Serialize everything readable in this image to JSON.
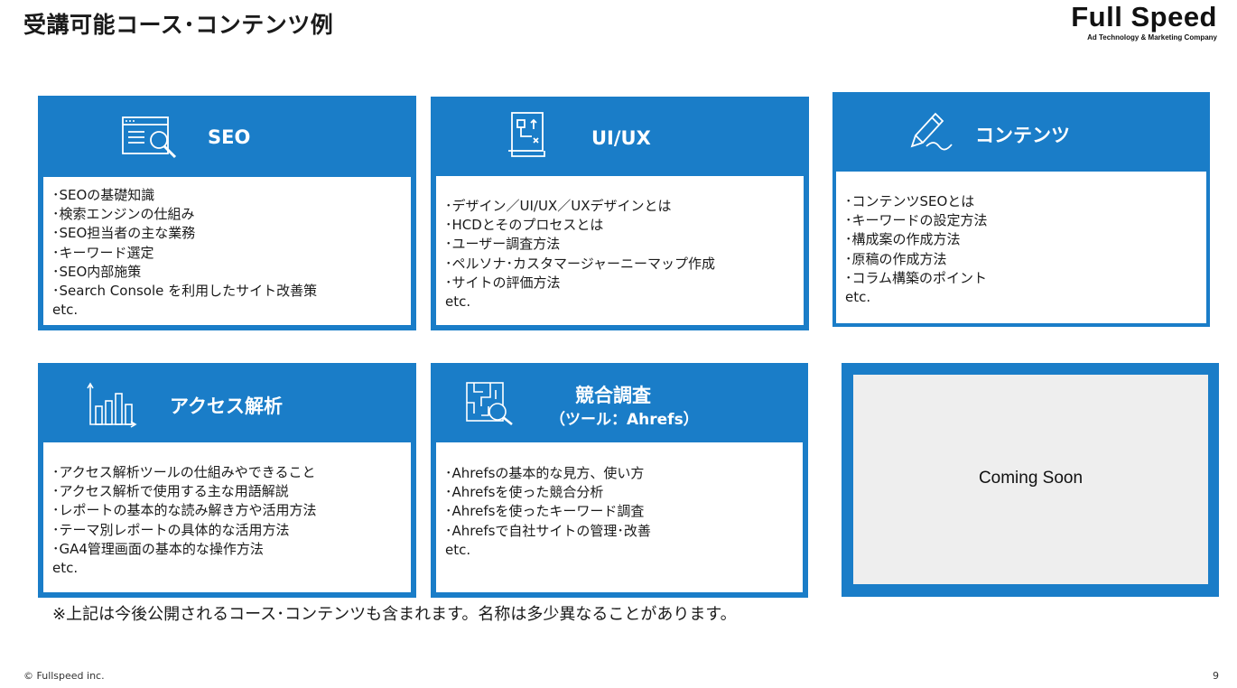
{
  "slide": {
    "title": "受講可能コース･コンテンツ例",
    "page_number": "9",
    "copyright": "© Fullspeed inc.",
    "note": "※上記は今後公開されるコース･コンテンツも含まれます。名称は多少異なることがあります。"
  },
  "logo": {
    "name": "Full Speed",
    "tagline": "Ad Technology & Marketing Company"
  },
  "cards": [
    {
      "title": "SEO",
      "icon": "browser-search-icon",
      "items": [
        "･SEOの基礎知識",
        "･検索エンジンの仕組み",
        "･SEO担当者の主な業務",
        "･キーワード選定",
        "･SEO内部施策",
        "･Search Console を利用したサイト改善策",
        "etc."
      ]
    },
    {
      "title": "UI/UX",
      "icon": "wireframe-icon",
      "items": [
        "･デザイン／UI/UX／UXデザインとは",
        "･HCDとそのプロセスとは",
        "･ユーザー調査方法",
        "･ペルソナ･カスタマージャーニーマップ作成",
        "･サイトの評価方法",
        "etc."
      ]
    },
    {
      "title": "コンテンツ",
      "icon": "pen-writing-icon",
      "items": [
        "･コンテンツSEOとは",
        "･キーワードの設定方法",
        "･構成案の作成方法",
        "･原稿の作成方法",
        "･コラム構築のポイント",
        "etc."
      ]
    },
    {
      "title": "アクセス解析",
      "icon": "bar-chart-icon",
      "items": [
        "･アクセス解析ツールの仕組みやできること",
        "･アクセス解析で使用する主な用語解説",
        "･レポートの基本的な読み解き方や活用方法",
        "･テーマ別レポートの具体的な活用方法",
        "･GA4管理画面の基本的な操作方法",
        "etc."
      ]
    },
    {
      "title": "競合調査",
      "subtitle": "（ツール：Ahrefs）",
      "icon": "maze-search-icon",
      "items": [
        "･Ahrefsの基本的な見方、使い方",
        "･Ahrefsを使った競合分析",
        "･Ahrefsを使ったキーワード調査",
        "･Ahrefsで自社サイトの管理･改善",
        "etc."
      ]
    }
  ],
  "coming_soon": {
    "label": "Coming Soon"
  },
  "colors": {
    "accent": "#1a7dc8",
    "placeholder": "#eeeeee"
  }
}
